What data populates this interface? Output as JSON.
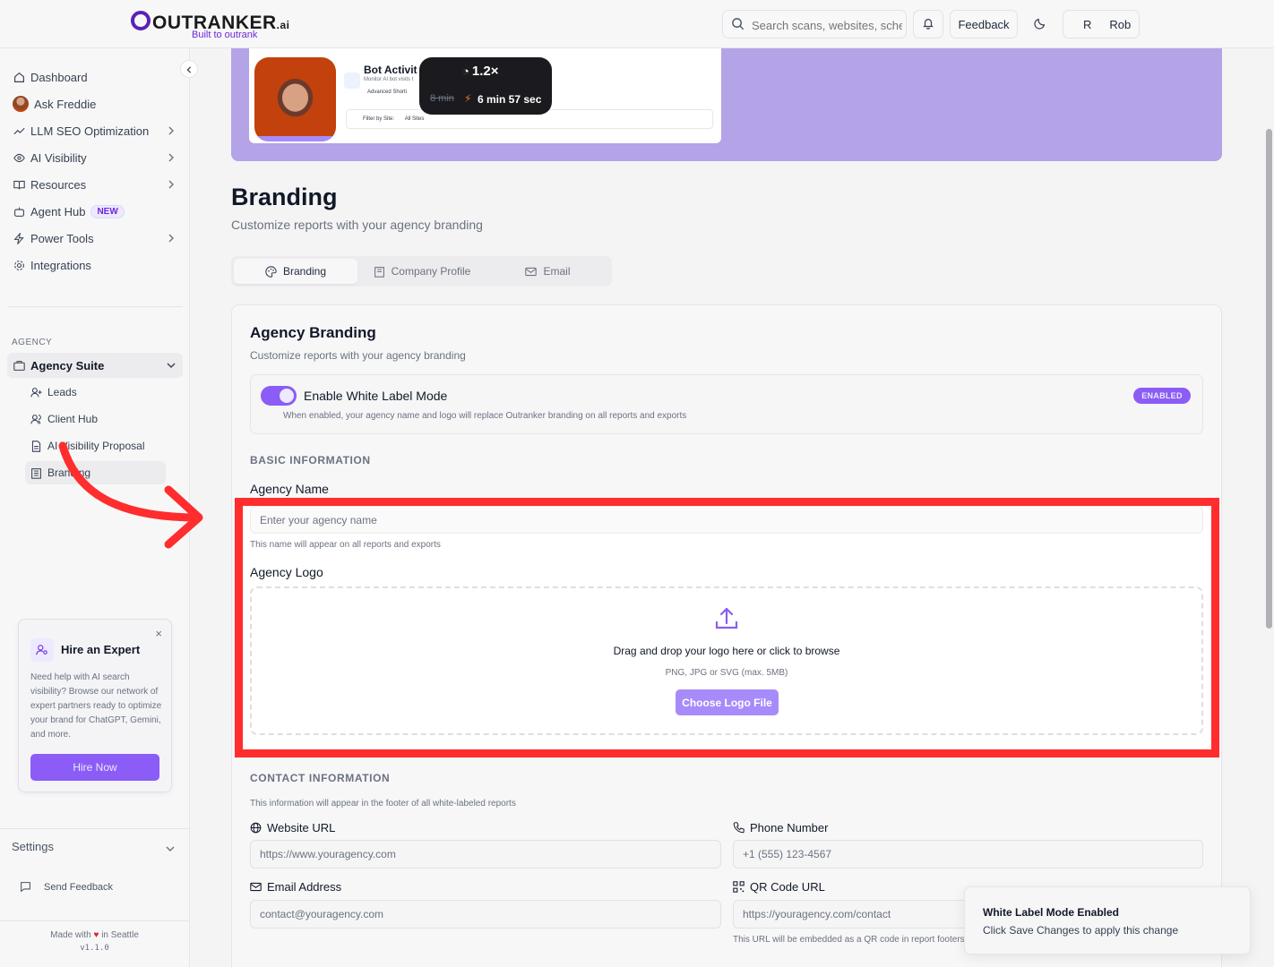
{
  "header": {
    "logo_text": "OUTRANKER",
    "logo_suffix": ".ai",
    "logo_tagline": "Built to outrank",
    "search_placeholder": "Search scans, websites, schema...",
    "feedback_label": "Feedback",
    "user_initial": "R",
    "user_name": "Rob"
  },
  "sidebar": {
    "items": [
      {
        "label": "Dashboard",
        "icon": "home-icon"
      },
      {
        "label": "Ask Freddie",
        "icon": "avatar"
      },
      {
        "label": "LLM SEO Optimization",
        "icon": "trend-icon"
      },
      {
        "label": "AI Visibility",
        "icon": "eye-icon"
      },
      {
        "label": "Resources",
        "icon": "book-icon"
      },
      {
        "label": "Agent Hub",
        "icon": "bot-icon",
        "badge": "NEW"
      },
      {
        "label": "Power Tools",
        "icon": "zap-icon"
      },
      {
        "label": "Integrations",
        "icon": "gear-icon"
      }
    ],
    "section_label": "AGENCY",
    "agency_suite": "Agency Suite",
    "sub_items": [
      {
        "label": "Leads",
        "icon": "user-plus-icon"
      },
      {
        "label": "Client Hub",
        "icon": "users-icon"
      },
      {
        "label": "AI Visibility Proposal",
        "icon": "file-icon"
      },
      {
        "label": "Branding",
        "icon": "building-icon"
      }
    ],
    "hire": {
      "title": "Hire an Expert",
      "body": "Need help with AI search visibility? Browse our network of expert partners ready to optimize your brand for ChatGPT, Gemini, and more.",
      "button": "Hire Now",
      "close": "×"
    },
    "settings_label": "Settings",
    "send_feedback": "Send Feedback",
    "made_with_prefix": "Made with",
    "made_with_suffix": "in Seattle",
    "version": "v1.1.0"
  },
  "video": {
    "title": "Bot Activit",
    "subtitle": "Monitor AI bot visits t",
    "row": "Advanced Shorti",
    "filter_label": "Filter by Site:",
    "filter_value": "All Sites",
    "speed": "1.2×",
    "old_time": "8 min",
    "new_time": "6 min 57 sec"
  },
  "page": {
    "title": "Branding",
    "subtitle": "Customize reports with your agency branding",
    "tabs": [
      {
        "label": "Branding",
        "icon": "palette-icon",
        "active": true
      },
      {
        "label": "Company Profile",
        "icon": "building-icon",
        "active": false
      },
      {
        "label": "Email",
        "icon": "mail-icon",
        "active": false
      }
    ]
  },
  "card": {
    "title": "Agency Branding",
    "subtitle": "Customize reports with your agency branding",
    "white_label": {
      "title": "Enable White Label Mode",
      "description": "When enabled, your agency name and logo will replace Outranker branding on all reports and exports",
      "badge": "ENABLED",
      "enabled": true
    },
    "basic_info_heading": "BASIC INFORMATION",
    "agency_name_label": "Agency Name",
    "agency_name_placeholder": "Enter your agency name",
    "agency_name_value": "",
    "agency_name_help": "This name will appear on all reports and exports",
    "agency_logo_label": "Agency Logo",
    "upload_text": "Drag and drop your logo here or click to browse",
    "upload_hint": "PNG, JPG or SVG (max. 5MB)",
    "choose_button": "Choose Logo File",
    "contact_heading": "CONTACT INFORMATION",
    "contact_help": "This information will appear in the footer of all white-labeled reports",
    "website_label": "Website URL",
    "website_placeholder": "https://www.youragency.com",
    "phone_label": "Phone Number",
    "phone_placeholder": "+1 (555) 123-4567",
    "email_label": "Email Address",
    "email_placeholder": "contact@youragency.com",
    "qr_label": "QR Code URL",
    "qr_placeholder": "https://youragency.com/contact",
    "qr_help": "This URL will be embedded as a QR code in report footers"
  },
  "toast": {
    "title": "White Label Mode Enabled",
    "message": "Click Save Changes to apply this change"
  },
  "colors": {
    "accent": "#8b5cf6",
    "hero": "#b4a3e6",
    "highlight": "#ff2d2d"
  }
}
